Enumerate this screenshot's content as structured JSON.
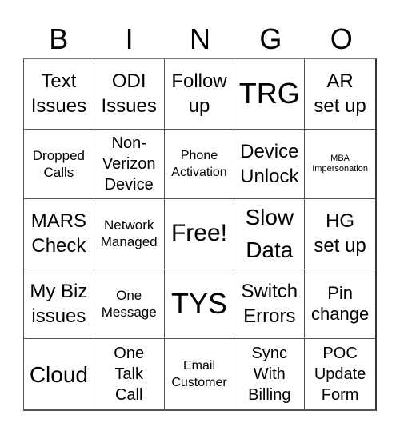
{
  "header": [
    "B",
    "I",
    "N",
    "G",
    "O"
  ],
  "cells": [
    {
      "text": "Text\nIssues",
      "size": "s24"
    },
    {
      "text": "ODI\nIssues",
      "size": "s24"
    },
    {
      "text": "Follow\nup",
      "size": "s24"
    },
    {
      "text": "TRG",
      "size": "s36"
    },
    {
      "text": "AR\nset up",
      "size": "s24"
    },
    {
      "text": "Dropped\nCalls",
      "size": "s17"
    },
    {
      "text": "Non-\nVerizon\nDevice",
      "size": "s20"
    },
    {
      "text": "Phone\nActivation",
      "size": "s16"
    },
    {
      "text": "Device\nUnlock",
      "size": "s24"
    },
    {
      "text": "MBA\nImpersonation",
      "size": "s12"
    },
    {
      "text": "MARS\nCheck",
      "size": "s24"
    },
    {
      "text": "Network\nManaged",
      "size": "s17"
    },
    {
      "text": "Free!",
      "size": "s30"
    },
    {
      "text": "Slow\nData",
      "size": "s28"
    },
    {
      "text": "HG\nset up",
      "size": "s24"
    },
    {
      "text": "My Biz\nissues",
      "size": "s24"
    },
    {
      "text": "One\nMessage",
      "size": "s17"
    },
    {
      "text": "TYS",
      "size": "s36"
    },
    {
      "text": "Switch\nErrors",
      "size": "s24"
    },
    {
      "text": "Pin\nchange",
      "size": "s22"
    },
    {
      "text": "Cloud",
      "size": "s28"
    },
    {
      "text": "One\nTalk\nCall",
      "size": "s20"
    },
    {
      "text": "Email\nCustomer",
      "size": "s16"
    },
    {
      "text": "Sync\nWith\nBilling",
      "size": "s20"
    },
    {
      "text": "POC\nUpdate\nForm",
      "size": "s20"
    }
  ]
}
